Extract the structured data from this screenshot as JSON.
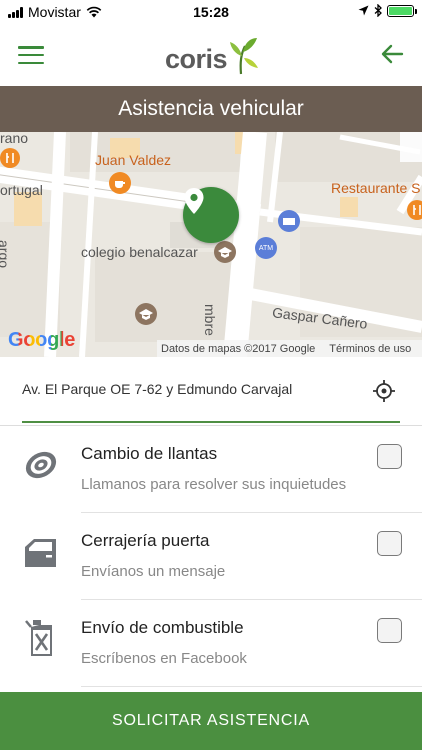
{
  "status_bar": {
    "carrier": "Movistar",
    "time": "15:28"
  },
  "header": {
    "logo_text": "coris"
  },
  "page_title": "Asistencia vehicular",
  "map": {
    "labels": {
      "rano": "rano",
      "juan_valdez": "Juan Valdez",
      "restaurante": "Restaurante S",
      "ortugal": "ortugal",
      "colegio": "colegio benalcazar",
      "atm": "ATM",
      "gaspar": "Gaspar Cañero",
      "embre": "mbre",
      "argo": "argo"
    },
    "google": "Google",
    "data_notice": "Datos de mapas ©2017 Google",
    "terms": "Términos de uso"
  },
  "address": {
    "value": "Av. El Parque OE 7-62 y Edmundo Carvajal"
  },
  "services": [
    {
      "icon": "tire-icon",
      "title": "Cambio de llantas",
      "subtitle": "Llamanos para resolver sus inquietudes"
    },
    {
      "icon": "car-door-icon",
      "title": "Cerrajería puerta",
      "subtitle": "Envíanos un mensaje"
    },
    {
      "icon": "fuel-can-icon",
      "title": "Envío de combustible",
      "subtitle": "Escríbenos en Facebook"
    }
  ],
  "cta_label": "SOLICITAR ASISTENCIA",
  "colors": {
    "brand_green": "#4b8f40",
    "title_band": "#6b5d52",
    "poi_orange": "#c8621d"
  }
}
